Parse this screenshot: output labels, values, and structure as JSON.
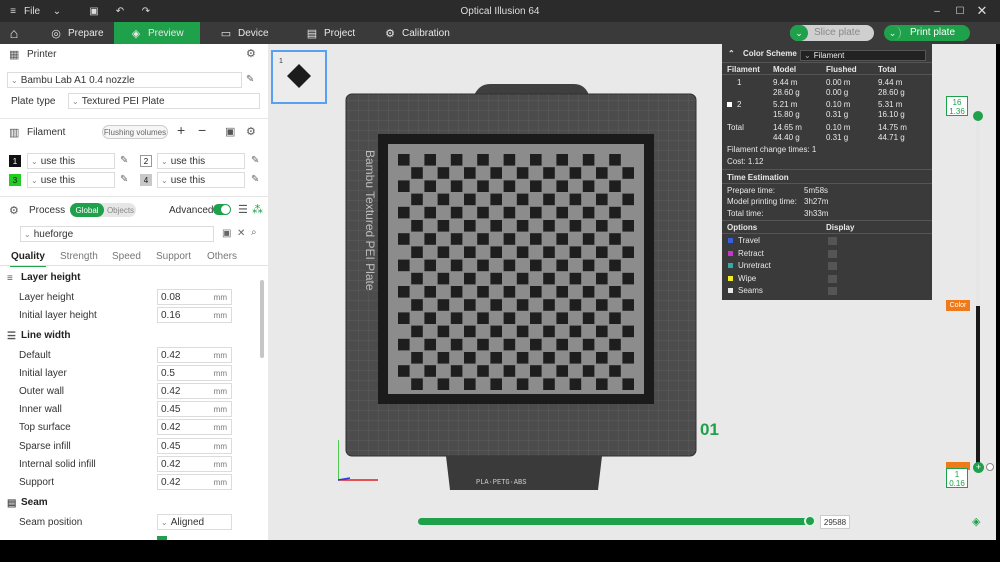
{
  "titlebar": {
    "file_label": "File",
    "window_title": "Optical Illusion 64",
    "menu_icon": "≡",
    "chevron": "⌄",
    "save_icon": "▣",
    "undo_icon": "↶",
    "redo_icon": "↷",
    "min_icon": "–",
    "max_icon": "☐",
    "close_icon": "✕"
  },
  "nav": {
    "home_icon": "⌂",
    "prepare": "Prepare",
    "preview": "Preview",
    "device": "Device",
    "project": "Project",
    "calibration": "Calibration",
    "prepare_icon": "◎",
    "preview_icon": "◈",
    "device_icon": "▭",
    "project_icon": "▤",
    "calibration_icon": "⚙",
    "slice_label": "Slice plate",
    "print_label": "Print plate",
    "toggle_icon": "⌄"
  },
  "printer": {
    "section_label": "Printer",
    "name": "Bambu Lab A1 0.4 nozzle",
    "plate_type_label": "Plate type",
    "plate_type": "Textured PEI Plate"
  },
  "filament": {
    "section_label": "Filament",
    "flushing_label": "Flushing volumes",
    "plus": "+",
    "minus": "−",
    "slots": [
      {
        "num": "1",
        "value": "use this",
        "color": "#111111"
      },
      {
        "num": "2",
        "value": "use this",
        "color": "#ffffff"
      },
      {
        "num": "3",
        "value": "use this",
        "color": "#22cc22"
      },
      {
        "num": "4",
        "value": "use this",
        "color": "#c8c8c8"
      }
    ]
  },
  "process": {
    "section_label": "Process",
    "global_label": "Global",
    "objects_label": "Objects",
    "advanced_label": "Advanced",
    "preset": "hueforge",
    "tabs": [
      "Quality",
      "Strength",
      "Speed",
      "Support",
      "Others"
    ],
    "layer_height_group": "Layer height",
    "line_width_group": "Line width",
    "seam_group": "Seam",
    "rows": {
      "layer_height": {
        "label": "Layer height",
        "value": "0.08",
        "unit": "mm"
      },
      "initial_layer_height": {
        "label": "Initial layer height",
        "value": "0.16",
        "unit": "mm"
      },
      "default": {
        "label": "Default",
        "value": "0.42",
        "unit": "mm"
      },
      "initial_layer": {
        "label": "Initial layer",
        "value": "0.5",
        "unit": "mm"
      },
      "outer_wall": {
        "label": "Outer wall",
        "value": "0.42",
        "unit": "mm"
      },
      "inner_wall": {
        "label": "Inner wall",
        "value": "0.45",
        "unit": "mm"
      },
      "top_surface": {
        "label": "Top surface",
        "value": "0.42",
        "unit": "mm"
      },
      "sparse_infill": {
        "label": "Sparse infill",
        "value": "0.45",
        "unit": "mm"
      },
      "internal_solid_infill": {
        "label": "Internal solid infill",
        "value": "0.42",
        "unit": "mm"
      },
      "support": {
        "label": "Support",
        "value": "0.42",
        "unit": "mm"
      },
      "seam_position": {
        "label": "Seam position",
        "value": "Aligned"
      }
    }
  },
  "viewport": {
    "plate_thumb_num": "1",
    "bed_label": "Bambu Textured PEI Plate",
    "bed_footer": "PLA·PETG·ABS",
    "plate_number": "01"
  },
  "legend": {
    "title": "Color Scheme",
    "scheme": "Filament",
    "headers": {
      "filament": "Filament",
      "model": "Model",
      "flushed": "Flushed",
      "total": "Total"
    },
    "rows": [
      {
        "id": "1",
        "model_m": "9.44 m",
        "model_g": "28.60 g",
        "flushed_m": "0.00 m",
        "flushed_g": "0.00 g",
        "total_m": "9.44 m",
        "total_g": "28.60 g"
      },
      {
        "id": "2",
        "model_m": "5.21 m",
        "model_g": "15.80 g",
        "flushed_m": "0.10 m",
        "flushed_g": "0.31 g",
        "total_m": "5.31 m",
        "total_g": "16.10 g"
      }
    ],
    "total": {
      "label": "Total",
      "model_m": "14.65 m",
      "model_g": "44.40 g",
      "flushed_m": "0.10 m",
      "flushed_g": "0.31 g",
      "total_m": "14.75 m",
      "total_g": "44.71 g"
    },
    "change_times": "Filament change times:  1",
    "cost": "Cost:  1.12",
    "time_title": "Time Estimation",
    "prepare_time_label": "Prepare time:",
    "prepare_time": "5m58s",
    "model_time_label": "Model printing time:",
    "model_time": "3h27m",
    "total_time_label": "Total time:",
    "total_time": "3h33m",
    "options_label": "Options",
    "display_label": "Display",
    "options": [
      {
        "name": "Travel",
        "color": "#3b5fd9"
      },
      {
        "name": "Retract",
        "color": "#cc33cc"
      },
      {
        "name": "Unretract",
        "color": "#33aaaa"
      },
      {
        "name": "Wipe",
        "color": "#eeee22"
      },
      {
        "name": "Seams",
        "color": "#e8e8e8"
      }
    ]
  },
  "slider": {
    "top_layer": "16",
    "top_height": "1.36",
    "bottom_layer": "1",
    "bottom_height": "0.16",
    "color_tag": "Color",
    "moves": "29588"
  }
}
